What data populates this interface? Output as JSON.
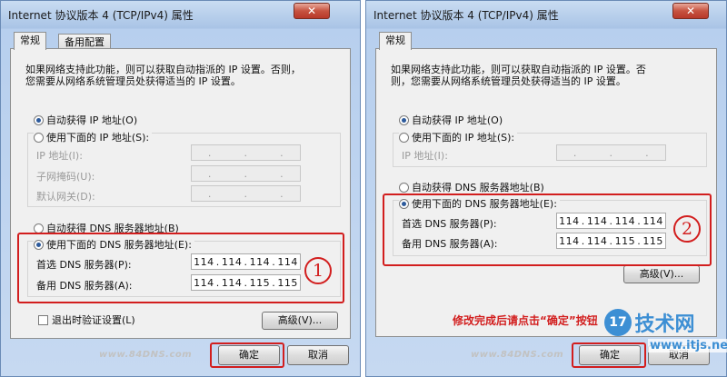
{
  "title": "Internet 协议版本 4 (TCP/IPv4) 属性",
  "close_glyph": "✕",
  "tabs": {
    "general": "常规",
    "alternate": "备用配置"
  },
  "desc_line1_left": "如果网络支持此功能，则可以获取自动指派的 IP 设置。否则，",
  "desc_line2": "您需要从网络系统管理员处获得适当的 IP 设置。",
  "desc_line1_right": "如果网络支持此功能，则可以获取自动指派的 IP 设置。否",
  "desc_line2_right": "则，您需要从网络系统管理员处获得适当的 IP 设置。",
  "auto_ip": "自动获得 IP 地址(O)",
  "use_ip": "使用下面的 IP 地址(S):",
  "ip_addr": "IP 地址(I):",
  "subnet": "子网掩码(U):",
  "gateway": "默认网关(D):",
  "auto_dns": "自动获得 DNS 服务器地址(B)",
  "use_dns": "使用下面的 DNS 服务器地址(E):",
  "pref_dns": "首选 DNS 服务器(P):",
  "alt_dns": "备用 DNS 服务器(A):",
  "pref_dns_value": [
    "114",
    "114",
    "114",
    "114"
  ],
  "alt_dns_value": [
    "114",
    "114",
    "115",
    "115"
  ],
  "validate": "退出时验证设置(L)",
  "advanced": "高级(V)...",
  "ok": "确定",
  "cancel": "取消",
  "cancel_partial": "取消",
  "circle1": "1",
  "circle2": "2",
  "instruction": "修改完成后请点击“确定”按钮",
  "watermark": "www.84DNS.com",
  "site_logo": {
    "number": "17",
    "word": "技术网",
    "url": "www.itjs.net"
  },
  "colors": {
    "annotation": "#d21e1e",
    "selected_radio": "#2c5a9c"
  }
}
